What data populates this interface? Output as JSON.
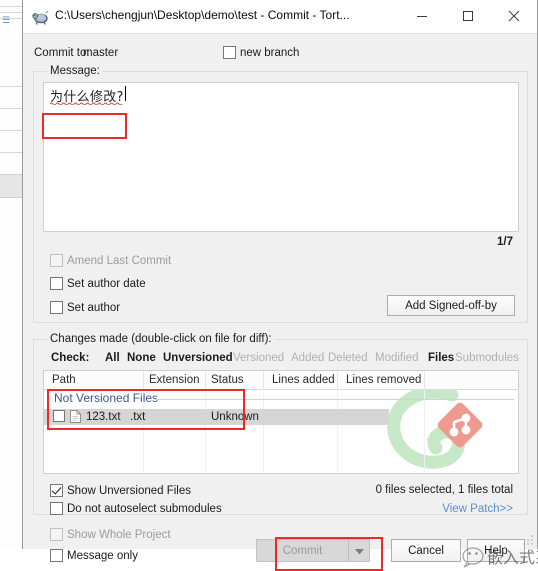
{
  "window": {
    "title": "C:\\Users\\chengjun\\Desktop\\demo\\test - Commit - Tort...",
    "icon": "tortoisegit-icon",
    "minimize_label": "Minimize",
    "maximize_label": "Maximize",
    "close_label": "Close"
  },
  "commit_to": {
    "label": "Commit to:",
    "branch": "master",
    "new_branch_label": "new branch",
    "new_branch_checked": false
  },
  "message": {
    "group_caption": "Message:",
    "text": "为什么修改?",
    "counter": "1/7"
  },
  "options": {
    "amend_label": "Amend Last Commit",
    "amend_checked": false,
    "amend_disabled": true,
    "set_author_date_label": "Set author date",
    "set_author_date_checked": false,
    "set_author_label": "Set author",
    "set_author_checked": false,
    "add_signed_off_label": "Add Signed-off-by"
  },
  "changes": {
    "group_caption": "Changes made (double-click on file for diff):",
    "check_label": "Check:",
    "filters": [
      {
        "label": "All",
        "enabled": true
      },
      {
        "label": "None",
        "enabled": true
      },
      {
        "label": "Unversioned",
        "enabled": true
      },
      {
        "label": "Versioned",
        "enabled": false
      },
      {
        "label": "Added",
        "enabled": false
      },
      {
        "label": "Deleted",
        "enabled": false
      },
      {
        "label": "Modified",
        "enabled": false
      },
      {
        "label": "Files",
        "enabled": true
      },
      {
        "label": "Submodules",
        "enabled": false
      }
    ],
    "columns": [
      "Path",
      "Extension",
      "Status",
      "Lines added",
      "Lines removed"
    ],
    "group_header": "Not Versioned Files",
    "rows": [
      {
        "checked": false,
        "icon": "file-icon",
        "path": "123.txt",
        "extension": ".txt",
        "status": "Unknown",
        "lines_added": "",
        "lines_removed": ""
      }
    ],
    "show_unversioned_label": "Show Unversioned Files",
    "show_unversioned_checked": true,
    "no_autoselect_label": "Do not autoselect submodules",
    "no_autoselect_checked": false,
    "file_count": "0 files selected, 1 files total",
    "view_patch": "View Patch>>"
  },
  "footer": {
    "show_whole_project_label": "Show Whole Project",
    "show_whole_project_checked": false,
    "show_whole_project_disabled": true,
    "message_only_label": "Message only",
    "message_only_checked": false,
    "commit_label": "Commit",
    "commit_disabled": true,
    "commit_dropdown_icon": "chevron-down-icon",
    "cancel_label": "Cancel",
    "help_label": "Help"
  },
  "watermark": {
    "text": "嵌入式系统",
    "logo": "wechat-icon"
  },
  "colors": {
    "accent_red": "#ee2a24",
    "link_blue": "#5a8fd0",
    "group_blue": "#3c5a8c",
    "dialog_bg": "#f0f0f0"
  }
}
